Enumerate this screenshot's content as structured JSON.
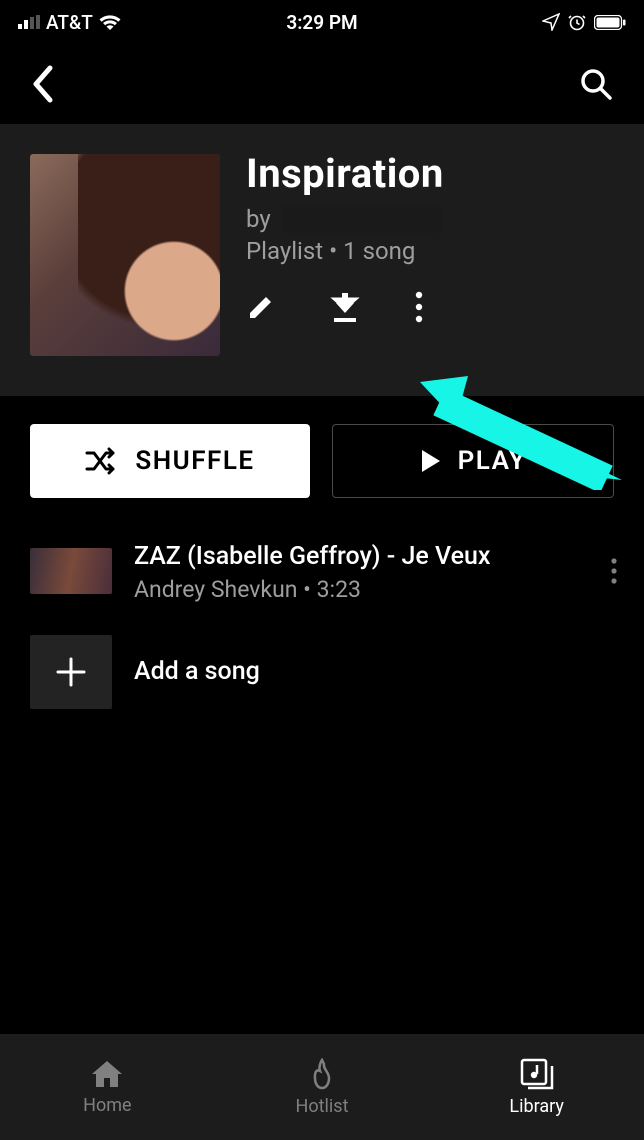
{
  "status_bar": {
    "carrier": "AT&T",
    "time": "3:29 PM"
  },
  "playlist": {
    "title": "Inspiration",
    "by_prefix": "by",
    "info": "Playlist • 1 song"
  },
  "buttons": {
    "shuffle": "SHUFFLE",
    "play": "PLAY"
  },
  "songs": [
    {
      "title": "ZAZ (Isabelle Geffroy) - Je Veux",
      "artist_duration": "Andrey Shevkun • 3:23"
    }
  ],
  "add_song": "Add a song",
  "nav": {
    "home": "Home",
    "hotlist": "Hotlist",
    "library": "Library"
  },
  "annotation": {
    "arrow_color": "#17f5e6"
  }
}
